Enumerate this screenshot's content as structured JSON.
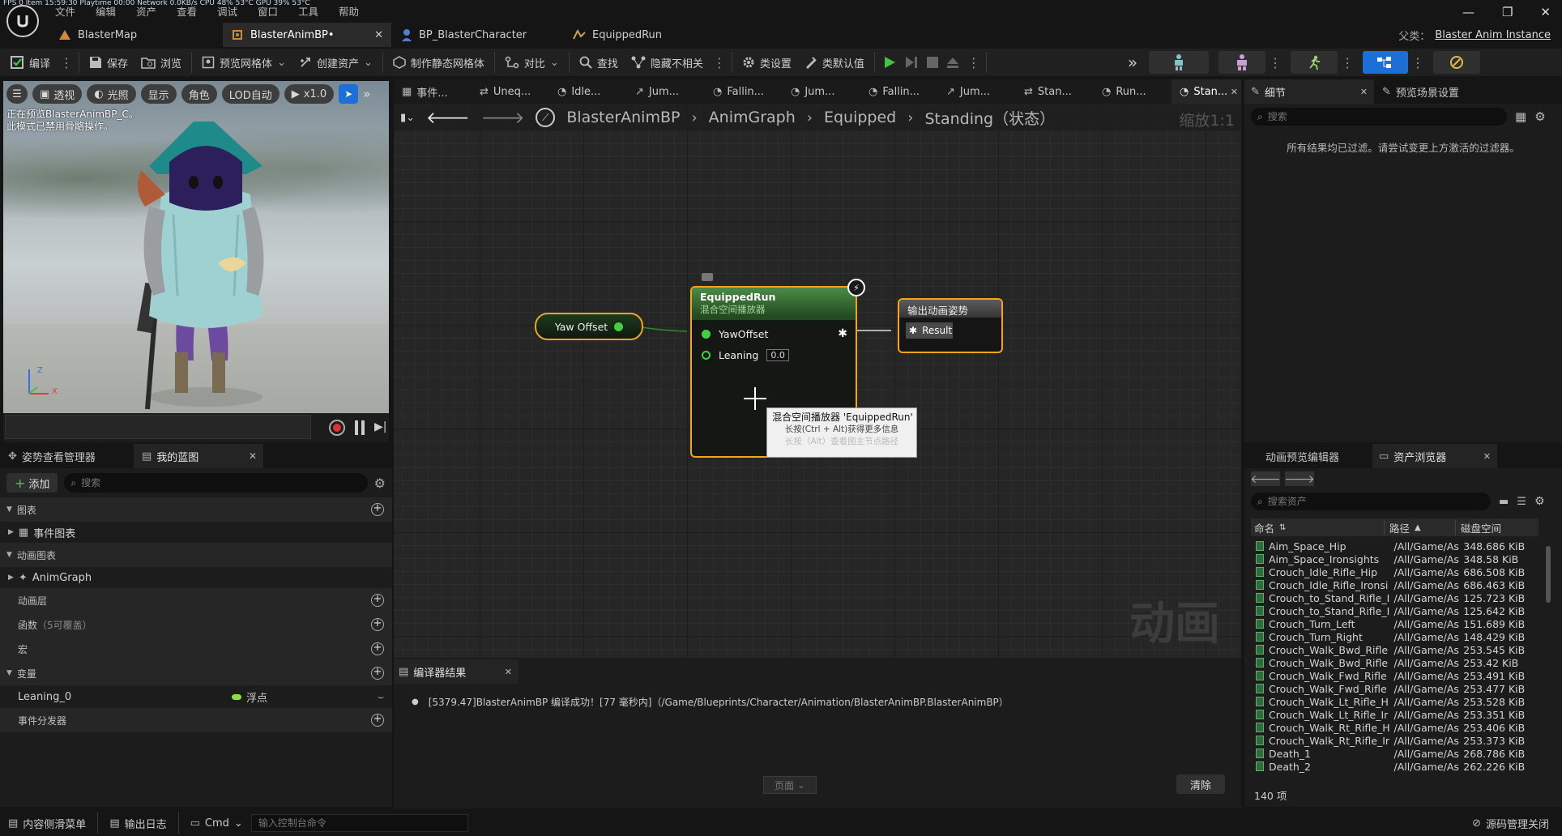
{
  "stats_bar": "FPS 0   Item 15:59:30   Playtime 00:00   Network 0.0KB/s   CPU 48% 53°C   GPU 39% 53°C",
  "menu": [
    "文件",
    "编辑",
    "资产",
    "查看",
    "调试",
    "窗口",
    "工具",
    "帮助"
  ],
  "doc_tabs": [
    {
      "label": "BlasterMap",
      "icon": "level-icon"
    },
    {
      "label": "BlasterAnimBP•",
      "icon": "anim-bp-icon",
      "active": true
    },
    {
      "label": "BP_BlasterCharacter",
      "icon": "character-bp-icon"
    },
    {
      "label": "EquippedRun",
      "icon": "blendspace-icon"
    }
  ],
  "parent_class": {
    "label": "父类：",
    "value": "Blaster Anim Instance"
  },
  "window_controls": {
    "min": "—",
    "restore": "❐",
    "close": "✕"
  },
  "toolbar": {
    "compile": "编译",
    "save": "保存",
    "browse": "浏览",
    "preview_mesh": "预览网格体",
    "create_asset": "创建资产",
    "make_static_mesh": "制作静态网格体",
    "diff": "对比",
    "find": "查找",
    "hide_unrelated": "隐藏不相关",
    "class_settings": "类设置",
    "class_defaults": "类默认值"
  },
  "viewport": {
    "buttons": [
      "透视",
      "光照",
      "显示",
      "角色",
      "LOD自动",
      "x1.0"
    ],
    "overlay_line1": "正在预览BlasterAnimBP_C。",
    "overlay_line2": "此模式已禁用骨骼操作。",
    "axis_x": "X",
    "axis_z": "Z"
  },
  "left_tabs": {
    "pose_manager": "姿势查看管理器",
    "my_blueprint": "我的蓝图"
  },
  "my_blueprint": {
    "add": "添加",
    "search_placeholder": "搜索",
    "graphs": "图表",
    "event_graph": "事件图表",
    "anim_graphs": "动画图表",
    "anim_graph": "AnimGraph",
    "anim_layers": "动画层",
    "functions": "函数",
    "functions_sub": "（5可覆盖）",
    "macros": "宏",
    "variables": "变量",
    "variable": {
      "name": "Leaning_0",
      "type": "浮点"
    },
    "event_dispatchers": "事件分发器"
  },
  "graph_tabs": [
    "事件...",
    "Uneq...",
    "Idle...",
    "Jum...",
    "Fallin...",
    "Jum...",
    "Fallin...",
    "Jum...",
    "Stan...",
    "Run...",
    "Stan..."
  ],
  "breadcrumb": [
    "BlasterAnimBP",
    "AnimGraph",
    "Equipped",
    "Standing（状态）"
  ],
  "zoom": "缩放1:1",
  "nodes": {
    "yaw": {
      "label": "Yaw Offset"
    },
    "blend": {
      "title": "EquippedRun",
      "subtitle": "混合空间播放器",
      "pin1": "YawOffset",
      "pin2": "Leaning",
      "pin2_value": "0.0"
    },
    "output": {
      "title": "输出动画姿势",
      "pin": "Result"
    }
  },
  "tooltip": {
    "line1": "混合空间播放器 'EquippedRun'",
    "line2": "长按(Ctrl + Alt)获得更多信息",
    "line3": "长按（Alt）查看图主节点路径"
  },
  "watermark": "动画",
  "compiler": {
    "tab": "编译器结果",
    "message": "[5379.47]BlasterAnimBP 编译成功！[77 毫秒内]（/Game/Blueprints/Character/Animation/BlasterAnimBP.BlasterAnimBP）",
    "page": "页面",
    "clear": "清除"
  },
  "details": {
    "tab": "细节",
    "preview_tab": "预览场景设置",
    "search_placeholder": "搜索",
    "filtered_message": "所有结果均已过滤。请尝试变更上方激活的过滤器。"
  },
  "asset_browser": {
    "tab_left": "动画预览编辑器",
    "tab": "资产浏览器",
    "search_placeholder": "搜索资产",
    "col_name": "命名",
    "col_path": "路径",
    "col_size": "磁盘空间",
    "rows": [
      {
        "name": "Aim_Space_Hip",
        "path": "/All/Game/As",
        "size": "348.686 KiB"
      },
      {
        "name": "Aim_Space_Ironsights",
        "path": "/All/Game/As",
        "size": "348.58 KiB"
      },
      {
        "name": "Crouch_Idle_Rifle_Hip",
        "path": "/All/Game/As",
        "size": "686.508 KiB"
      },
      {
        "name": "Crouch_Idle_Rifle_Ironsi",
        "path": "/All/Game/As",
        "size": "686.463 KiB"
      },
      {
        "name": "Crouch_to_Stand_Rifle_I",
        "path": "/All/Game/As",
        "size": "125.723 KiB"
      },
      {
        "name": "Crouch_to_Stand_Rifle_I",
        "path": "/All/Game/As",
        "size": "125.642 KiB"
      },
      {
        "name": "Crouch_Turn_Left",
        "path": "/All/Game/As",
        "size": "151.689 KiB"
      },
      {
        "name": "Crouch_Turn_Right",
        "path": "/All/Game/As",
        "size": "148.429 KiB"
      },
      {
        "name": "Crouch_Walk_Bwd_Rifle",
        "path": "/All/Game/As",
        "size": "253.545 KiB"
      },
      {
        "name": "Crouch_Walk_Bwd_Rifle",
        "path": "/All/Game/As",
        "size": "253.42 KiB"
      },
      {
        "name": "Crouch_Walk_Fwd_Rifle",
        "path": "/All/Game/As",
        "size": "253.491 KiB"
      },
      {
        "name": "Crouch_Walk_Fwd_Rifle",
        "path": "/All/Game/As",
        "size": "253.477 KiB"
      },
      {
        "name": "Crouch_Walk_Lt_Rifle_H",
        "path": "/All/Game/As",
        "size": "253.528 KiB"
      },
      {
        "name": "Crouch_Walk_Lt_Rifle_Ir",
        "path": "/All/Game/As",
        "size": "253.351 KiB"
      },
      {
        "name": "Crouch_Walk_Rt_Rifle_H",
        "path": "/All/Game/As",
        "size": "253.406 KiB"
      },
      {
        "name": "Crouch_Walk_Rt_Rifle_Ir",
        "path": "/All/Game/As",
        "size": "253.373 KiB"
      },
      {
        "name": "Death_1",
        "path": "/All/Game/As",
        "size": "268.786 KiB"
      },
      {
        "name": "Death_2",
        "path": "/All/Game/As",
        "size": "262.226 KiB"
      }
    ],
    "count": "140 项"
  },
  "status_bar": {
    "content_drawer": "内容侧滑菜单",
    "output_log": "输出日志",
    "cmd": "Cmd",
    "console_placeholder": "输入控制台命令",
    "source_control": "源码管理关闭"
  }
}
